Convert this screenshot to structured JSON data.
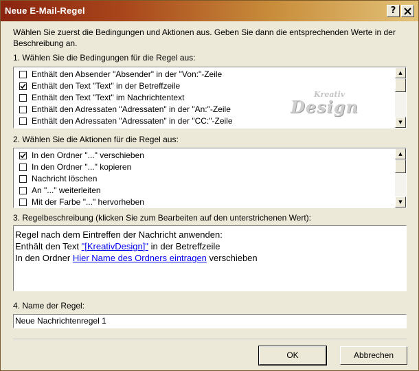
{
  "title": "Neue E-Mail-Regel",
  "title_buttons": {
    "help": "?",
    "close": "X"
  },
  "intro": "Wählen Sie zuerst die Bedingungen und Aktionen aus. Geben Sie dann die entsprechenden Werte in der Beschreibung an.",
  "conditions": {
    "label": "1. Wählen Sie die Bedingungen für die Regel aus:",
    "items": [
      {
        "label": "Enthält den Absender \"Absender\" in der \"Von:\"-Zeile",
        "checked": false
      },
      {
        "label": "Enthält den Text \"Text\" in der Betreffzeile",
        "checked": true
      },
      {
        "label": "Enthält den Text \"Text\" im Nachrichtentext",
        "checked": false
      },
      {
        "label": "Enthält den Adressaten \"Adressaten\" in der \"An:\"-Zeile",
        "checked": false
      },
      {
        "label": "Enthält den Adressaten \"Adressaten\" in der \"CC:\"-Zeile",
        "checked": false
      }
    ]
  },
  "actions": {
    "label": "2. Wählen Sie die Aktionen für die Regel aus:",
    "items": [
      {
        "label": "In den Ordner \"...\" verschieben",
        "checked": true
      },
      {
        "label": "In den Ordner \"...\" kopieren",
        "checked": false
      },
      {
        "label": "Nachricht löschen",
        "checked": false
      },
      {
        "label": "An \"...\" weiterleiten",
        "checked": false
      },
      {
        "label": "Mit der Farbe \"...\" hervorheben",
        "checked": false
      }
    ]
  },
  "description": {
    "label": "3. Regelbeschreibung (klicken Sie zum Bearbeiten auf den unterstrichenen Wert):",
    "line1": "Regel nach dem Eintreffen der Nachricht anwenden:",
    "line2_prefix": "Enthält den Text ",
    "line2_link": "\"[KreativDesign]\"",
    "line2_suffix": " in der Betreffzeile",
    "line3_prefix": "In den Ordner ",
    "line3_link": "Hier Name des Ordners eintragen",
    "line3_suffix": " verschieben"
  },
  "rule_name": {
    "label": "4. Name der Regel:",
    "value": "Neue Nachrichtenregel 1"
  },
  "buttons": {
    "ok": "OK",
    "cancel": "Abbrechen"
  },
  "watermark": {
    "top": "Kreativ",
    "main": "Design"
  },
  "scroll_icons": {
    "up": "▲",
    "down": "▼"
  },
  "colors": {
    "title_start": "#8b2410",
    "title_end": "#e3c278",
    "link": "#0000ee",
    "face": "#ece9d8"
  }
}
